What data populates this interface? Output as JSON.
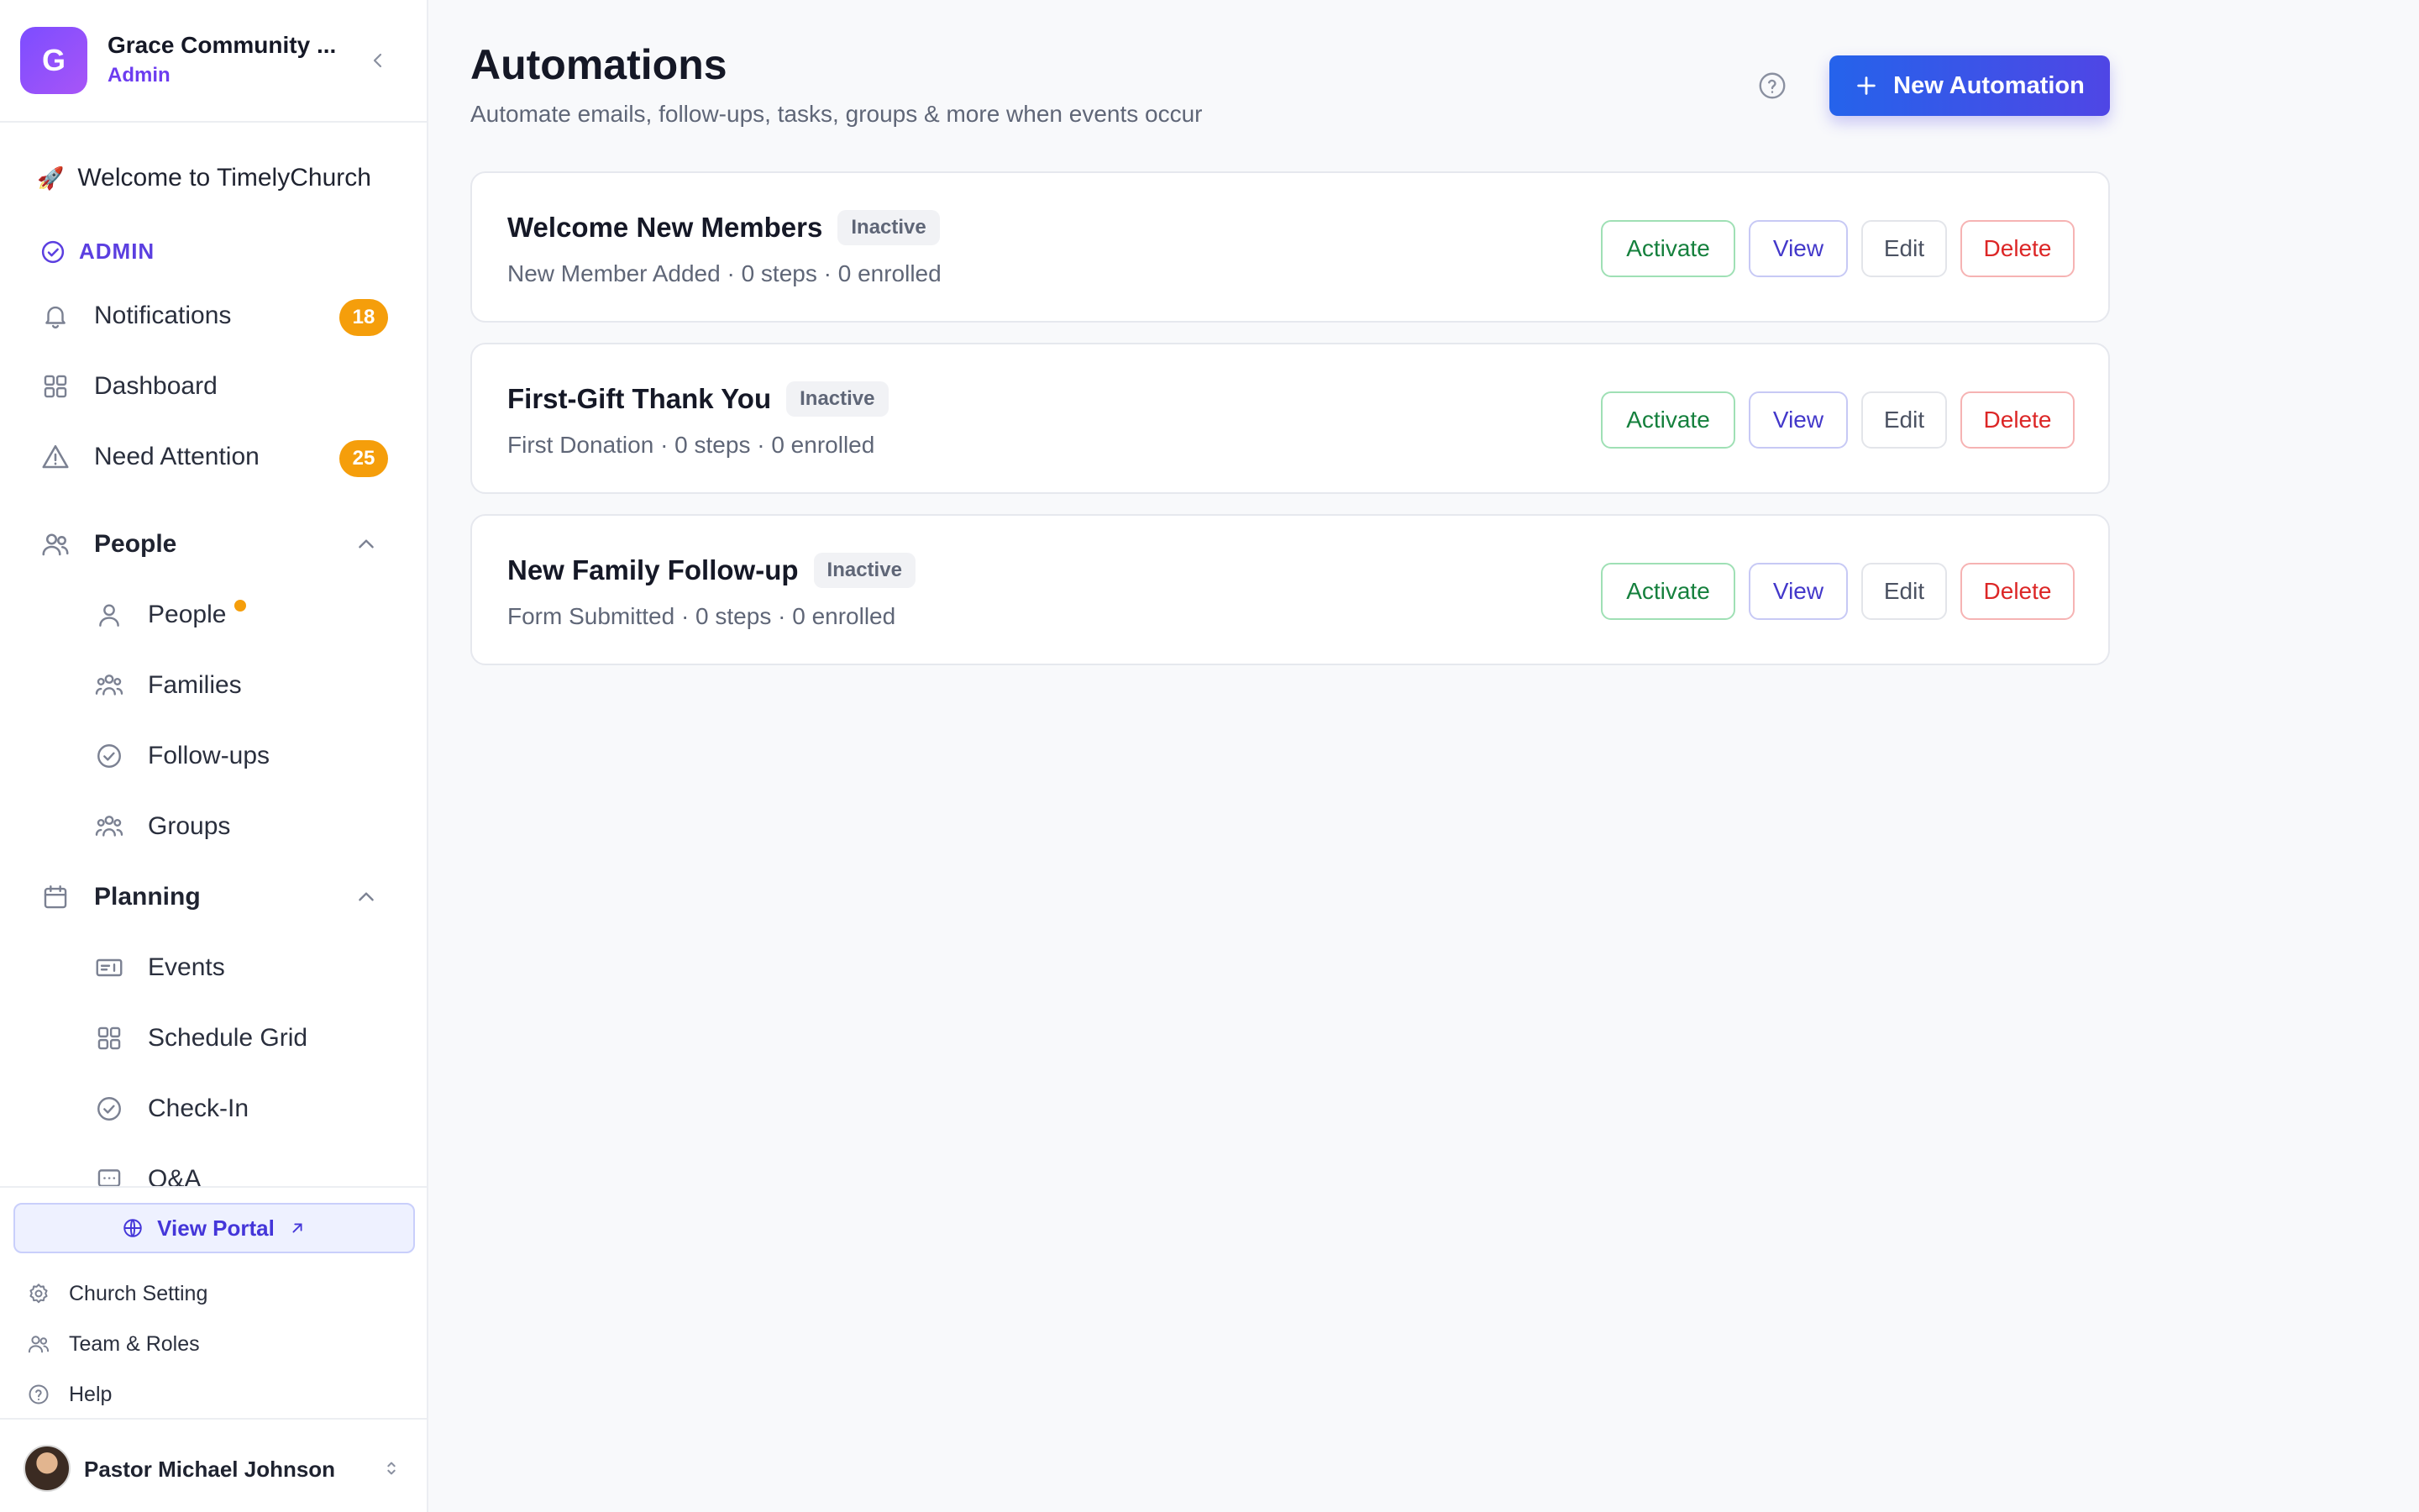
{
  "org": {
    "initial": "G",
    "name": "Grace Community ...",
    "role": "Admin"
  },
  "nav": {
    "welcome": {
      "emoji": "🚀",
      "label": "Welcome to TimelyChurch"
    },
    "section_admin": "ADMIN",
    "notifications": {
      "label": "Notifications",
      "badge": "18"
    },
    "dashboard": {
      "label": "Dashboard"
    },
    "need_attention": {
      "label": "Need Attention",
      "badge": "25"
    },
    "people_group": {
      "label": "People"
    },
    "people_items": [
      {
        "label": "People"
      },
      {
        "label": "Families"
      },
      {
        "label": "Follow-ups"
      },
      {
        "label": "Groups"
      }
    ],
    "planning_group": {
      "label": "Planning"
    },
    "planning_items": [
      {
        "label": "Events"
      },
      {
        "label": "Schedule Grid"
      },
      {
        "label": "Check-In"
      },
      {
        "label": "Q&A"
      }
    ]
  },
  "footer": {
    "portal": "View Portal",
    "church_setting": "Church Setting",
    "team_roles": "Team & Roles",
    "help": "Help",
    "user_name": "Pastor Michael Johnson"
  },
  "header": {
    "title": "Automations",
    "subtitle": "Automate emails, follow-ups, tasks, groups & more when events occur",
    "new_button": "New Automation"
  },
  "actions": {
    "activate": "Activate",
    "view": "View",
    "edit": "Edit",
    "delete": "Delete"
  },
  "automations": [
    {
      "name": "Welcome New Members",
      "status": "Inactive",
      "meta": "New Member Added · 0 steps · 0 enrolled"
    },
    {
      "name": "First-Gift Thank You",
      "status": "Inactive",
      "meta": "First Donation · 0 steps · 0 enrolled"
    },
    {
      "name": "New Family Follow-up",
      "status": "Inactive",
      "meta": "Form Submitted · 0 steps · 0 enrolled"
    }
  ],
  "colors": {
    "accent": "#4f46e5",
    "badge": "#f59e0b",
    "active_green": "#15803d",
    "danger": "#dc2626"
  }
}
